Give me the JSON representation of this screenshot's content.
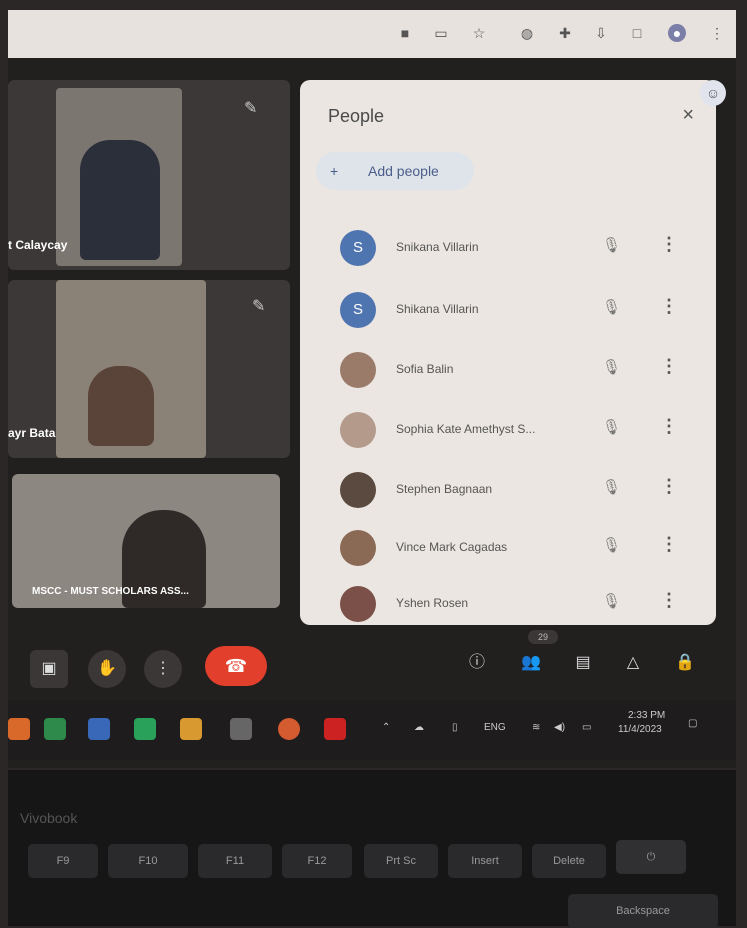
{
  "browser": {
    "icons": [
      "camera-icon",
      "cast-icon",
      "star-icon",
      "extension-icon",
      "puzzle-icon",
      "download-icon",
      "split-view-icon",
      "profile-icon",
      "menu-dots-icon"
    ]
  },
  "tiles": [
    {
      "name": "t Calaycay"
    },
    {
      "name": "ayr Bata"
    },
    {
      "name": "MSCC - MUST SCHOLARS ASS..."
    }
  ],
  "people_panel": {
    "title": "People",
    "add_label": "Add people",
    "participants": [
      {
        "initial": "S",
        "name": "Snikana Villarin",
        "avatar": "letter"
      },
      {
        "initial": "S",
        "name": "Shikana Villarin",
        "avatar": "letter"
      },
      {
        "initial": "",
        "name": "Sofia Balin",
        "avatar": "photo"
      },
      {
        "initial": "",
        "name": "Sophia Kate Amethyst S...",
        "avatar": "photo"
      },
      {
        "initial": "",
        "name": "Stephen Bagnaan",
        "avatar": "photo"
      },
      {
        "initial": "",
        "name": "Vince Mark Cagadas",
        "avatar": "photo"
      },
      {
        "initial": "",
        "name": "Yshen Rosen",
        "avatar": "photo"
      }
    ]
  },
  "controls": {
    "participant_count": "29"
  },
  "taskbar": {
    "lang": "ENG",
    "time": "2:33 PM",
    "date": "11/4/2023"
  },
  "keyboard": {
    "keys": [
      "F9",
      "F10",
      "F11",
      "F12",
      "Prt Sc",
      "Insert",
      "Delete"
    ],
    "label": "Backspace",
    "brand": "Vivobook"
  }
}
